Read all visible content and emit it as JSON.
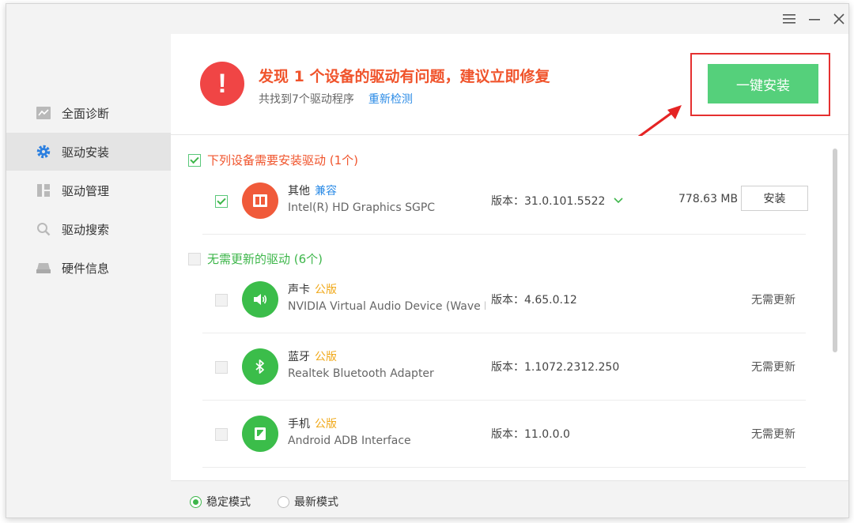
{
  "sidebar": {
    "items": [
      {
        "label": "全面诊断",
        "icon": "diagnosis-icon"
      },
      {
        "label": "驱动安装",
        "icon": "gear-icon"
      },
      {
        "label": "驱动管理",
        "icon": "grid-icon"
      },
      {
        "label": "驱动搜索",
        "icon": "search-icon"
      },
      {
        "label": "硬件信息",
        "icon": "hardware-icon"
      }
    ],
    "active_index": 1
  },
  "header": {
    "alert_title": "发现 1 个设备的驱动有问题，建议立即修复",
    "alert_sub": "共找到7个驱动程序",
    "rescan_link": "重新检测",
    "install_all_label": "一键安装"
  },
  "sections": {
    "need_install": {
      "title": "下列设备需要安装驱动 (1个)",
      "checked": true
    },
    "no_update": {
      "title": "无需更新的驱动 (6个)",
      "checked": false
    }
  },
  "drivers_need": [
    {
      "type": "其他",
      "tag": "兼容",
      "name": "Intel(R) HD Graphics SGPC",
      "version": "版本：31.0.101.5522",
      "size": "778.63 MB",
      "action": "安装",
      "icon": "display-icon"
    }
  ],
  "drivers_ok": [
    {
      "type": "声卡",
      "tag": "公版",
      "name": "NVIDIA Virtual Audio Device (Wave Extensible)",
      "version": "版本：4.65.0.12",
      "status": "无需更新",
      "icon": "speaker-icon"
    },
    {
      "type": "蓝牙",
      "tag": "公版",
      "name": "Realtek Bluetooth Adapter",
      "version": "版本：1.1072.2312.250",
      "status": "无需更新",
      "icon": "bluetooth-icon"
    },
    {
      "type": "手机",
      "tag": "公版",
      "name": "Android ADB Interface",
      "version": "版本：11.0.0.0",
      "status": "无需更新",
      "icon": "phone-icon"
    }
  ],
  "footer": {
    "mode_stable": "稳定模式",
    "mode_latest": "最新模式",
    "selected": "stable"
  },
  "colors": {
    "accent_green": "#55d07b",
    "alert_red": "#f04545",
    "link_blue": "#2b8be6",
    "tag_orange": "#f0a818"
  }
}
